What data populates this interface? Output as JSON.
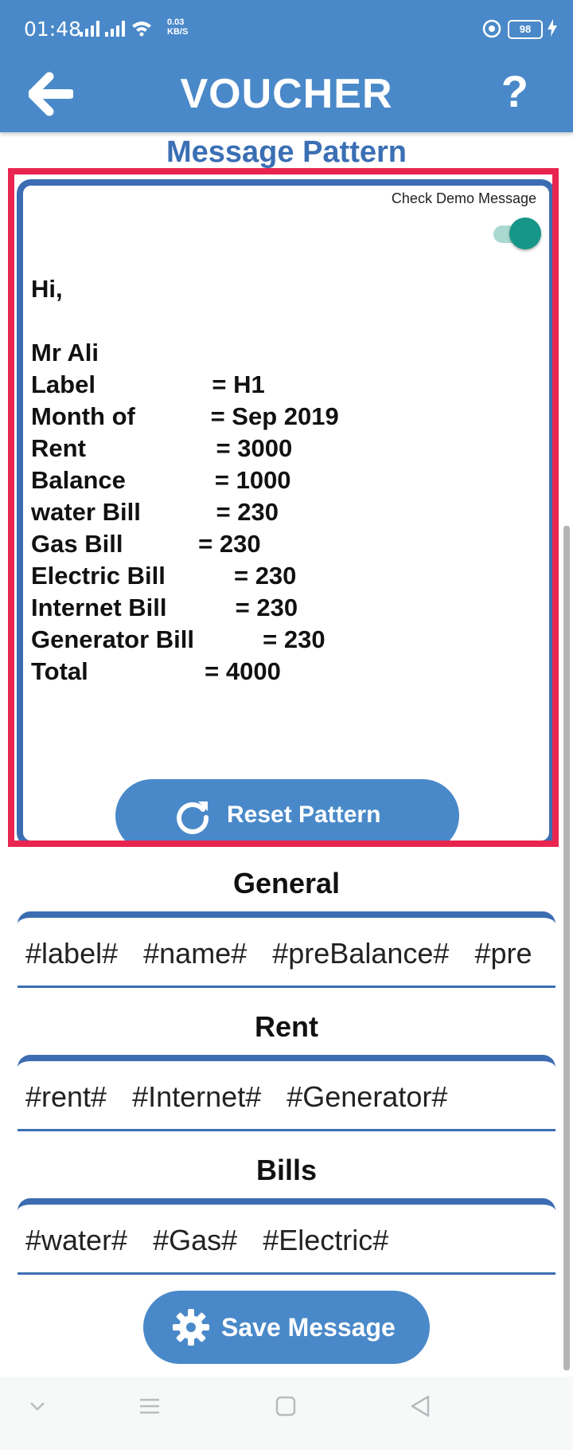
{
  "status_bar": {
    "time": "01:48",
    "net_speed": "0.03",
    "net_unit": "KB/S",
    "battery": "98"
  },
  "app_bar": {
    "title": "VOUCHER",
    "help_label": "?"
  },
  "message_pattern": {
    "heading": "Message Pattern",
    "demo_toggle_label": "Check Demo Message",
    "demo_toggle_on": true,
    "message_text": "Hi,\n\nMr Ali\nLabel                 = H1\nMonth of           = Sep 2019\nRent                   = 3000\nBalance             = 1000\nwater Bill           = 230\nGas Bill           = 230\nElectric Bill          = 230\nInternet Bill          = 230\nGenerator Bill          = 230\nTotal                 = 4000",
    "reset_label": "Reset Pattern"
  },
  "groups": [
    {
      "title": "General",
      "tags": [
        "#label#",
        "#name#",
        "#preBalance#",
        "#pre"
      ]
    },
    {
      "title": "Rent",
      "tags": [
        "#rent#",
        "#Internet#",
        "#Generator#"
      ]
    },
    {
      "title": "Bills",
      "tags": [
        "#water#",
        "#Gas#",
        "#Electric#"
      ]
    }
  ],
  "save_label": "Save Message",
  "colors": {
    "primary": "#4a89c9",
    "border": "#3c6db2",
    "highlight": "#e8254f",
    "toggle": "#169688"
  }
}
